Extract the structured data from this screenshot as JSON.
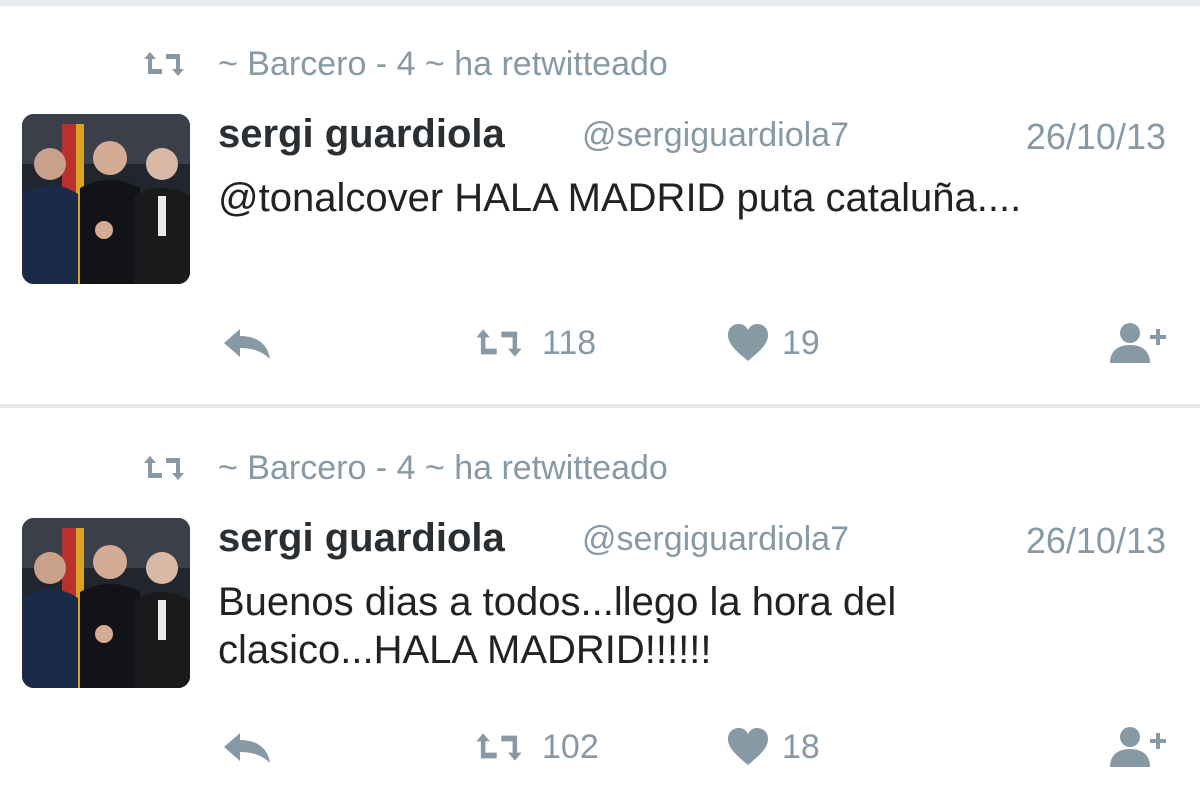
{
  "colors": {
    "muted": "#8899a6",
    "text": "#222222",
    "name": "#292f33"
  },
  "tweets": [
    {
      "retweeted_by": "~ Barcero - 4 ~ ha retwitteado",
      "author_name": "sergi guardiola",
      "handle": "@sergiguardiola7",
      "date": "26/10/13",
      "text": "@tonalcover HALA MADRID puta cataluña....",
      "retweets": "118",
      "likes": "19",
      "icons": [
        "retweet-icon",
        "reply-icon",
        "heart-icon",
        "follow-icon"
      ]
    },
    {
      "retweeted_by": "~ Barcero - 4 ~ ha retwitteado",
      "author_name": "sergi guardiola",
      "handle": "@sergiguardiola7",
      "date": "26/10/13",
      "text": "Buenos dias a todos...llego la hora del clasico...HALA MADRID!!!!!!",
      "retweets": "102",
      "likes": "18",
      "icons": [
        "retweet-icon",
        "reply-icon",
        "heart-icon",
        "follow-icon"
      ]
    }
  ]
}
